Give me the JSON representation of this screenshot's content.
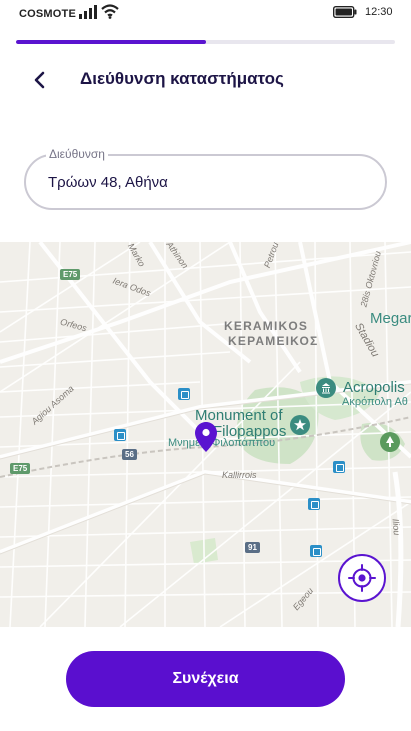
{
  "status_bar": {
    "carrier": "COSMOTE",
    "time": "12:30",
    "icons": [
      "signal-icon",
      "wifi-icon",
      "battery-icon"
    ]
  },
  "progress": {
    "value_percent": 50
  },
  "header": {
    "back_icon": "chevron-left-icon",
    "title": "Διεύθυνση καταστήματος"
  },
  "address": {
    "label": "Διεύθυνση",
    "value": "Τρώων 48, Αθήνα"
  },
  "map": {
    "streets": [
      "Athinon",
      "Petrou",
      "Marko",
      "Iera Odos",
      "Orfeos",
      "Agiou Asoma",
      "Kallirrois",
      "28is Oktovriou",
      "Stadiou",
      "Iliou",
      "Egeou"
    ],
    "districts": [
      "KERAMIKOS",
      "ΚΕΡΑΜΕΙΚΟΣ"
    ],
    "pois": {
      "acropolis_en": "Acropolis",
      "acropolis_gr": "Ακρόπολη Αθ",
      "monument_en_1": "Monument of",
      "monument_en_2": "Filopappos",
      "monument_gr": "Μνημείο Φιλοπάππου",
      "partial": "Megar"
    },
    "road_shields": [
      "E75",
      "E75",
      "56",
      "91"
    ],
    "locate_icon": "crosshair-icon",
    "pin_icon": "location-pin-icon"
  },
  "actions": {
    "continue_label": "Συνέχεια"
  },
  "colors": {
    "accent": "#5a14d0",
    "button": "#5a0fcf",
    "title": "#1d1546",
    "map_bg": "#f1efea",
    "park": "#cfe3c7"
  }
}
